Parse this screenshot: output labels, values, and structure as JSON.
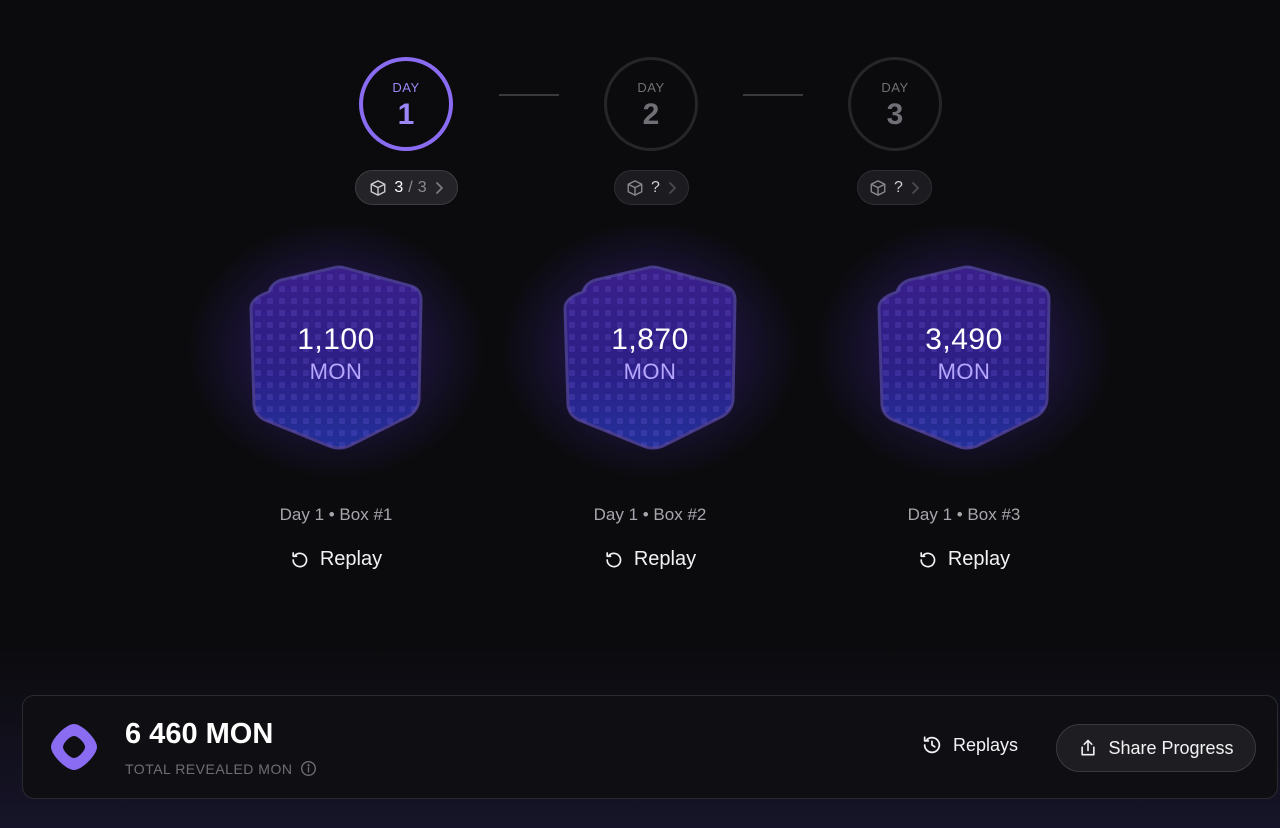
{
  "days": [
    {
      "word": "DAY",
      "number": "1",
      "active": true,
      "pill": {
        "current": "3",
        "separator": "/",
        "total": "3"
      }
    },
    {
      "word": "DAY",
      "number": "2",
      "active": false,
      "pill": {
        "current": "?"
      }
    },
    {
      "word": "DAY",
      "number": "3",
      "active": false,
      "pill": {
        "current": "?"
      }
    }
  ],
  "boxes": [
    {
      "value": "1,100",
      "unit": "MON",
      "label": "Day 1 • Box #1",
      "replay_label": "Replay"
    },
    {
      "value": "1,870",
      "unit": "MON",
      "label": "Day 1 • Box #2",
      "replay_label": "Replay"
    },
    {
      "value": "3,490",
      "unit": "MON",
      "label": "Day 1 • Box #3",
      "replay_label": "Replay"
    }
  ],
  "summary": {
    "total_value": "6 460 MON",
    "total_label": "TOTAL REVEALED MON",
    "replays_label": "Replays",
    "share_label": "Share Progress"
  },
  "colors": {
    "accent": "#8a6cf2",
    "unit_text": "#b7a6ff",
    "background": "#0b0b0e"
  },
  "icons": {
    "pill_icon": "cube-icon",
    "pill_arrow": "chevron-right-icon",
    "replay": "replay-icon",
    "replays": "history-icon",
    "share": "share-icon",
    "info": "info-icon",
    "logo": "monad-logo"
  }
}
